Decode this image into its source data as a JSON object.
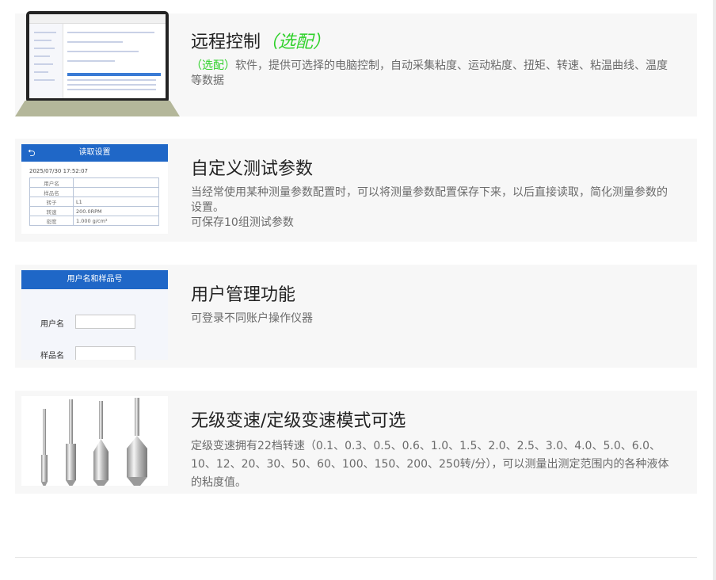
{
  "features": [
    {
      "title": "远程控制",
      "title_option": "（选配）",
      "desc_option": "（选配）",
      "desc_lines": [
        "软件，提供可选择的电脑控制，自动采集粘度、运动粘度、扭矩、转速、粘温曲线、温度等数据"
      ]
    },
    {
      "title": "自定义测试参数",
      "desc_lines": [
        "当经常使用某种测量参数配置时，可以将测量参数配置保存下来，以后直接读取，简化测量参数的设置。",
        "可保存10组测试参数"
      ],
      "panel": {
        "header": "读取设置",
        "back_glyph": "⮌",
        "datetime": "2025/07/30 17:52:07",
        "rows": [
          {
            "label": "用户名",
            "value": ""
          },
          {
            "label": "样品名",
            "value": ""
          },
          {
            "label": "转子",
            "value": "L1"
          },
          {
            "label": "转速",
            "value": "200.0RPM"
          },
          {
            "label": "密度",
            "value": "1.000 g/cm³"
          }
        ]
      }
    },
    {
      "title": "用户管理功能",
      "desc_lines": [
        "可登录不同账户操作仪器"
      ],
      "panel": {
        "header": "用户名和样品号",
        "fields": [
          {
            "label": "用户名"
          },
          {
            "label": "样品名"
          }
        ]
      }
    },
    {
      "title": "无级变速/定级变速模式可选",
      "desc_lines": [
        "定级变速拥有22档转速（0.1、0.3、0.5、0.6、1.0、1.5、2.0、2.5、3.0、4.0、5.0、6.0、10、12、20、30、50、60、100、150、200、250转/分），可以测量出测定范围内的各种液体的粘度值。"
      ]
    }
  ],
  "colors": {
    "accent_green": "#2fd12a",
    "panel_blue": "#1f67c7",
    "card_bg": "#f7f7f7"
  }
}
